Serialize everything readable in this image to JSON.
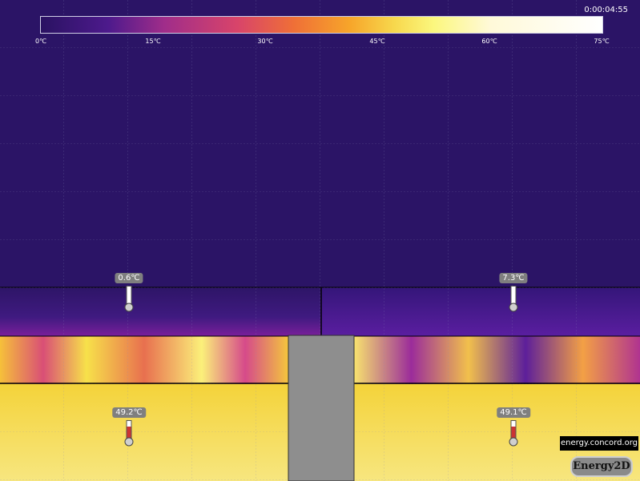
{
  "timer": "0:00:04:55",
  "scale_ticks": [
    "0℃",
    "15℃",
    "30℃",
    "45℃",
    "60℃",
    "75℃"
  ],
  "sensors": [
    "0.6℃",
    "7.3℃",
    "49.2℃",
    "49.1℃"
  ],
  "site": "energy.concord.org",
  "logo": "Energy2D",
  "colors": {
    "cold": "#2b1466",
    "warm": "#f5e27a",
    "partition": "#8e8e8e"
  }
}
